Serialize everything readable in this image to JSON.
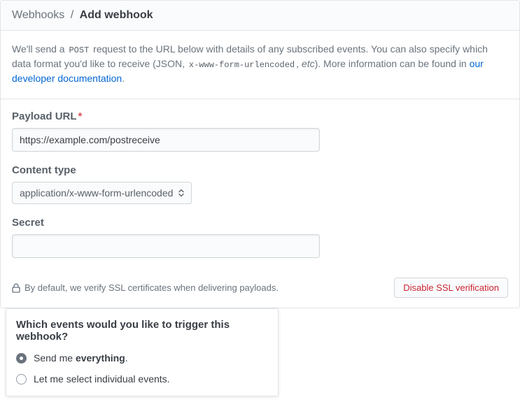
{
  "breadcrumb": {
    "parent": "Webhooks",
    "sep": "/",
    "current": "Add webhook"
  },
  "intro": {
    "t1": "We'll send a ",
    "code1": "POST",
    "t2": " request to the URL below with details of any subscribed events. You can also specify which data format you'd like to receive (JSON, ",
    "code2": "x-www-form-urlencoded",
    "t3": ", ",
    "etc": "etc",
    "t4": "). More information can be found in ",
    "link": "our developer documentation",
    "t5": "."
  },
  "payload": {
    "label": "Payload URL",
    "required_mark": "*",
    "value": "https://example.com/postreceive"
  },
  "content_type": {
    "label": "Content type",
    "value": "application/x-www-form-urlencoded"
  },
  "secret": {
    "label": "Secret",
    "value": ""
  },
  "ssl": {
    "note": "By default, we verify SSL certificates when delivering payloads.",
    "button": "Disable SSL verification"
  },
  "events": {
    "title": "Which events would you like to trigger this webhook?",
    "opts": [
      {
        "pre": "Send me ",
        "em": "everything",
        "post": ".",
        "checked": true
      },
      {
        "pre": "Let me select individual events.",
        "em": "",
        "post": "",
        "checked": false
      }
    ]
  }
}
